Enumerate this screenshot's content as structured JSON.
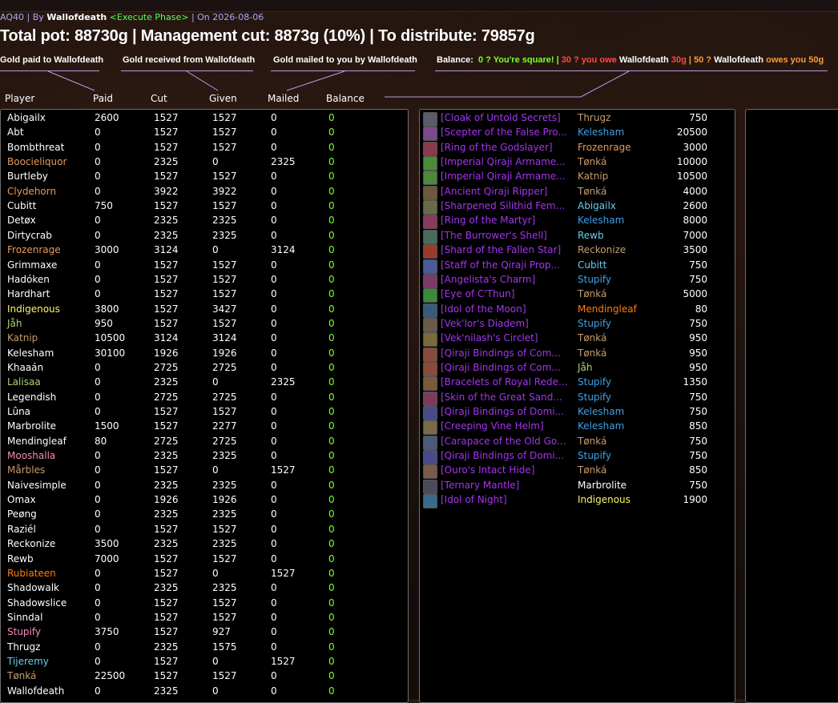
{
  "meta": {
    "raid": "AQ40",
    "by_label": "| By",
    "author": "Wallofdeath",
    "phase": "<Execute Phase>",
    "date_label": "| On 2026-08-06"
  },
  "headline": "Total pot: 88730g | Management cut: 8873g (10%) | To distribute: 79857g",
  "legend": {
    "paid": "Gold paid to Wallofdeath",
    "received": "Gold received from Wallofdeath",
    "mailed": "Gold mailed to you by Wallofdeath",
    "balance_label": "Balance:",
    "square": "0 ? You're square!",
    "sep1": "|",
    "owe_num": "30 ? you owe",
    "owe_name": "Wallofdeath",
    "owe_amt": "30g",
    "sep2": "|",
    "owes_num": "50 ?",
    "owes_name": "Wallofdeath",
    "owes_rest": "owes you 50g"
  },
  "columns": {
    "player": "Player",
    "paid": "Paid",
    "cut": "Cut",
    "given": "Given",
    "mailed": "Mailed",
    "balance": "Balance"
  },
  "colors": {
    "priest": "#ffffff",
    "druid": "#ff7d0a",
    "warrior": "#c79c6e",
    "mage": "#69ccf0",
    "hunter": "#abd473",
    "paladin": "#f58cba",
    "rogue": "#fff569",
    "epic": "#a335ee",
    "legendary": "#ff8000",
    "zero_green": "#7dff32"
  },
  "players": [
    {
      "name": "Abigailx",
      "paid": "2600",
      "cut": "1527",
      "given": "1527",
      "mailed": "0",
      "balance": "0",
      "color": "#ffffff"
    },
    {
      "name": "Abt",
      "paid": "0",
      "cut": "1527",
      "given": "1527",
      "mailed": "0",
      "balance": "0",
      "color": "#ffffff"
    },
    {
      "name": "Bombthreat",
      "paid": "0",
      "cut": "1527",
      "given": "1527",
      "mailed": "0",
      "balance": "0",
      "color": "#ffffff"
    },
    {
      "name": "Boocieliquor",
      "paid": "0",
      "cut": "2325",
      "given": "0",
      "mailed": "2325",
      "balance": "0",
      "color": "#e69a5a"
    },
    {
      "name": "Burtleby",
      "paid": "0",
      "cut": "1527",
      "given": "1527",
      "mailed": "0",
      "balance": "0",
      "color": "#ffffff"
    },
    {
      "name": "Clydehorn",
      "paid": "0",
      "cut": "3922",
      "given": "3922",
      "mailed": "0",
      "balance": "0",
      "color": "#e69a5a"
    },
    {
      "name": "Cubitt",
      "paid": "750",
      "cut": "1527",
      "given": "1527",
      "mailed": "0",
      "balance": "0",
      "color": "#ffffff"
    },
    {
      "name": "Detøx",
      "paid": "0",
      "cut": "2325",
      "given": "2325",
      "mailed": "0",
      "balance": "0",
      "color": "#ffffff"
    },
    {
      "name": "Dirtycrab",
      "paid": "0",
      "cut": "2325",
      "given": "2325",
      "mailed": "0",
      "balance": "0",
      "color": "#ffffff"
    },
    {
      "name": "Frozenrage",
      "paid": "3000",
      "cut": "3124",
      "given": "0",
      "mailed": "3124",
      "balance": "0",
      "color": "#e69a5a"
    },
    {
      "name": "Grimmaxe",
      "paid": "0",
      "cut": "1527",
      "given": "1527",
      "mailed": "0",
      "balance": "0",
      "color": "#ffffff"
    },
    {
      "name": "Hadóken",
      "paid": "0",
      "cut": "1527",
      "given": "1527",
      "mailed": "0",
      "balance": "0",
      "color": "#ffffff"
    },
    {
      "name": "Hardhart",
      "paid": "0",
      "cut": "1527",
      "given": "1527",
      "mailed": "0",
      "balance": "0",
      "color": "#ffffff"
    },
    {
      "name": "Indigenous",
      "paid": "3800",
      "cut": "1527",
      "given": "3427",
      "mailed": "0",
      "balance": "0",
      "color": "#fff569"
    },
    {
      "name": "Jåh",
      "paid": "950",
      "cut": "1527",
      "given": "1527",
      "mailed": "0",
      "balance": "0",
      "color": "#abd473"
    },
    {
      "name": "Katnip",
      "paid": "10500",
      "cut": "3124",
      "given": "3124",
      "mailed": "0",
      "balance": "0",
      "color": "#c79c6e"
    },
    {
      "name": "Kelesham",
      "paid": "30100",
      "cut": "1926",
      "given": "1926",
      "mailed": "0",
      "balance": "0",
      "color": "#ffffff"
    },
    {
      "name": "Khaaán",
      "paid": "0",
      "cut": "2725",
      "given": "2725",
      "mailed": "0",
      "balance": "0",
      "color": "#ffffff"
    },
    {
      "name": "Lalisaa",
      "paid": "0",
      "cut": "2325",
      "given": "0",
      "mailed": "2325",
      "balance": "0",
      "color": "#abd473"
    },
    {
      "name": "Legendish",
      "paid": "0",
      "cut": "2725",
      "given": "2725",
      "mailed": "0",
      "balance": "0",
      "color": "#ffffff"
    },
    {
      "name": "Lûna",
      "paid": "0",
      "cut": "1527",
      "given": "1527",
      "mailed": "0",
      "balance": "0",
      "color": "#ffffff"
    },
    {
      "name": "Marbrolite",
      "paid": "1500",
      "cut": "1527",
      "given": "2277",
      "mailed": "0",
      "balance": "0",
      "color": "#ffffff"
    },
    {
      "name": "Mendingleaf",
      "paid": "80",
      "cut": "2725",
      "given": "2725",
      "mailed": "0",
      "balance": "0",
      "color": "#ffffff"
    },
    {
      "name": "Mooshalla",
      "paid": "0",
      "cut": "2325",
      "given": "2325",
      "mailed": "0",
      "balance": "0",
      "color": "#f58cba"
    },
    {
      "name": "Mårbles",
      "paid": "0",
      "cut": "1527",
      "given": "0",
      "mailed": "1527",
      "balance": "0",
      "color": "#c79c6e"
    },
    {
      "name": "Naivesimple",
      "paid": "0",
      "cut": "2325",
      "given": "2325",
      "mailed": "0",
      "balance": "0",
      "color": "#ffffff"
    },
    {
      "name": "Omax",
      "paid": "0",
      "cut": "1926",
      "given": "1926",
      "mailed": "0",
      "balance": "0",
      "color": "#ffffff"
    },
    {
      "name": "Peøng",
      "paid": "0",
      "cut": "2325",
      "given": "2325",
      "mailed": "0",
      "balance": "0",
      "color": "#ffffff"
    },
    {
      "name": "Raziél",
      "paid": "0",
      "cut": "1527",
      "given": "1527",
      "mailed": "0",
      "balance": "0",
      "color": "#ffffff"
    },
    {
      "name": "Reckonize",
      "paid": "3500",
      "cut": "2325",
      "given": "2325",
      "mailed": "0",
      "balance": "0",
      "color": "#ffffff"
    },
    {
      "name": "Rewb",
      "paid": "7000",
      "cut": "1527",
      "given": "1527",
      "mailed": "0",
      "balance": "0",
      "color": "#ffffff"
    },
    {
      "name": "Rubiateen",
      "paid": "0",
      "cut": "1527",
      "given": "0",
      "mailed": "1527",
      "balance": "0",
      "color": "#ff7d0a"
    },
    {
      "name": "Shadowalk",
      "paid": "0",
      "cut": "2325",
      "given": "2325",
      "mailed": "0",
      "balance": "0",
      "color": "#ffffff"
    },
    {
      "name": "Shadowslice",
      "paid": "0",
      "cut": "1527",
      "given": "1527",
      "mailed": "0",
      "balance": "0",
      "color": "#ffffff"
    },
    {
      "name": "Sinndal",
      "paid": "0",
      "cut": "1527",
      "given": "1527",
      "mailed": "0",
      "balance": "0",
      "color": "#ffffff"
    },
    {
      "name": "Stupify",
      "paid": "3750",
      "cut": "1527",
      "given": "927",
      "mailed": "0",
      "balance": "0",
      "color": "#f58cba"
    },
    {
      "name": "Thrugz",
      "paid": "0",
      "cut": "2325",
      "given": "1575",
      "mailed": "0",
      "balance": "0",
      "color": "#ffffff"
    },
    {
      "name": "Tijeremy",
      "paid": "0",
      "cut": "1527",
      "given": "0",
      "mailed": "1527",
      "balance": "0",
      "color": "#69ccf0"
    },
    {
      "name": "Tønká",
      "paid": "22500",
      "cut": "1527",
      "given": "1527",
      "mailed": "0",
      "balance": "0",
      "color": "#c79c6e"
    },
    {
      "name": "Wallofdeath",
      "paid": "0",
      "cut": "2325",
      "given": "0",
      "mailed": "0",
      "balance": "0",
      "color": "#ffffff"
    }
  ],
  "loot": [
    {
      "item": "[Cloak of Untold Secrets]",
      "winner": "Thrugz",
      "price": "750",
      "wcolor": "#c79c6e",
      "icon": "#5a5a6a"
    },
    {
      "item": "[Scepter of the False Pro...",
      "winner": "Kelesham",
      "price": "20500",
      "wcolor": "#3ea0e6",
      "icon": "#7a4a8a"
    },
    {
      "item": "[Ring of the Godslayer]",
      "winner": "Frozenrage",
      "price": "3000",
      "wcolor": "#e69a5a",
      "icon": "#8a3a4a"
    },
    {
      "item": "[Imperial Qiraji Armame...",
      "winner": "Tønká",
      "price": "10000",
      "wcolor": "#c79c6e",
      "icon": "#4a8a3a"
    },
    {
      "item": "[Imperial Qiraji Armame...",
      "winner": "Katnip",
      "price": "10500",
      "wcolor": "#c79c6e",
      "icon": "#4a8a3a"
    },
    {
      "item": "[Ancient Qiraji Ripper]",
      "winner": "Tønká",
      "price": "4000",
      "wcolor": "#c79c6e",
      "icon": "#6a5a3a"
    },
    {
      "item": "[Sharpened Silithid Fem...",
      "winner": "Abigailx",
      "price": "2600",
      "wcolor": "#69ccf0",
      "icon": "#6a6a4a"
    },
    {
      "item": "[Ring of the Martyr]",
      "winner": "Kelesham",
      "price": "8000",
      "wcolor": "#3ea0e6",
      "icon": "#8a3a5a"
    },
    {
      "item": "[The Burrower's Shell]",
      "winner": "Rewb",
      "price": "7000",
      "wcolor": "#69ccf0",
      "icon": "#4a6a5a"
    },
    {
      "item": "[Shard of the Fallen Star]",
      "winner": "Reckonize",
      "price": "3500",
      "wcolor": "#c79c6e",
      "icon": "#9a3a2a"
    },
    {
      "item": "[Staff of the Qiraji Prop...",
      "winner": "Cubitt",
      "price": "750",
      "wcolor": "#69ccf0",
      "icon": "#4a5a9a"
    },
    {
      "item": "[Angelista's Charm]",
      "winner": "Stupify",
      "price": "750",
      "wcolor": "#3ea0e6",
      "icon": "#7a3a6a"
    },
    {
      "item": "[Eye of C'Thun]",
      "winner": "Tønká",
      "price": "5000",
      "wcolor": "#c79c6e",
      "icon": "#3a8a3a"
    },
    {
      "item": "[Idol of the Moon]",
      "winner": "Mendingleaf",
      "price": "80",
      "wcolor": "#ff7d0a",
      "icon": "#3a5a7a"
    },
    {
      "item": "[Vek'lor's Diadem]",
      "winner": "Stupify",
      "price": "750",
      "wcolor": "#3ea0e6",
      "icon": "#6a5a4a"
    },
    {
      "item": "[Vek'nilash's Circlet]",
      "winner": "Tønká",
      "price": "950",
      "wcolor": "#c79c6e",
      "icon": "#7a6a3a"
    },
    {
      "item": "[Qiraji Bindings of Com...",
      "winner": "Tønká",
      "price": "950",
      "wcolor": "#c79c6e",
      "icon": "#8a4a3a"
    },
    {
      "item": "[Qiraji Bindings of Com...",
      "winner": "Jåh",
      "price": "950",
      "wcolor": "#abd473",
      "icon": "#8a4a3a"
    },
    {
      "item": "[Bracelets of Royal Rede...",
      "winner": "Stupify",
      "price": "1350",
      "wcolor": "#3ea0e6",
      "icon": "#7a5a3a"
    },
    {
      "item": "[Skin of the Great Sand...",
      "winner": "Stupify",
      "price": "750",
      "wcolor": "#3ea0e6",
      "icon": "#7a3a5a"
    },
    {
      "item": "[Qiraji Bindings of Domi...",
      "winner": "Kelesham",
      "price": "750",
      "wcolor": "#3ea0e6",
      "icon": "#4a4a8a"
    },
    {
      "item": "[Creeping Vine Helm]",
      "winner": "Kelesham",
      "price": "850",
      "wcolor": "#3ea0e6",
      "icon": "#7a6a4a"
    },
    {
      "item": "[Carapace of the Old Go...",
      "winner": "Tønká",
      "price": "750",
      "wcolor": "#c79c6e",
      "icon": "#4a5a7a"
    },
    {
      "item": "[Qiraji Bindings of Domi...",
      "winner": "Stupify",
      "price": "750",
      "wcolor": "#3ea0e6",
      "icon": "#4a4a8a"
    },
    {
      "item": "[Ouro's Intact Hide]",
      "winner": "Tønká",
      "price": "850",
      "wcolor": "#c79c6e",
      "icon": "#7a5a4a"
    },
    {
      "item": "[Ternary Mantle]",
      "winner": "Marbrolite",
      "price": "750",
      "wcolor": "#ffffff",
      "icon": "#4a4a5a"
    },
    {
      "item": "[Idol of Night]",
      "winner": "Indigenous",
      "price": "1900",
      "wcolor": "#fff569",
      "icon": "#3a6a8a"
    }
  ]
}
